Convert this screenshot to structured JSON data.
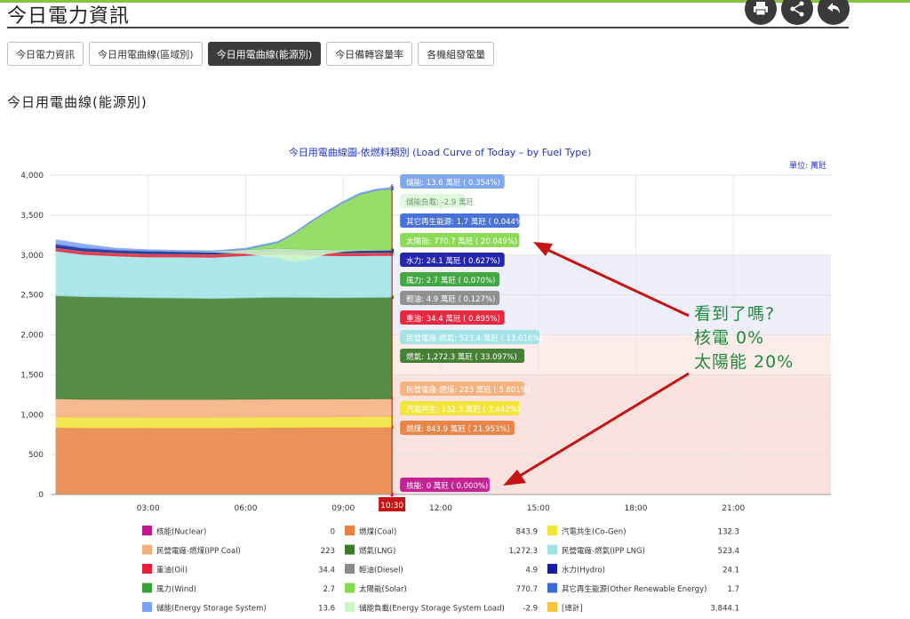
{
  "header": {
    "title": "今日電力資訊",
    "buttons": [
      {
        "name": "print-button",
        "icon": "printer-icon"
      },
      {
        "name": "share-button",
        "icon": "share-icon"
      },
      {
        "name": "back-button",
        "icon": "back-arrow-icon"
      }
    ]
  },
  "tabs": [
    {
      "label": "今日電力資訊",
      "active": false
    },
    {
      "label": "今日用電曲線(區域別)",
      "active": false
    },
    {
      "label": "今日用電曲線(能源別)",
      "active": true
    },
    {
      "label": "今日備轉容量率",
      "active": false
    },
    {
      "label": "各機組發電量",
      "active": false
    }
  ],
  "section_title": "今日用電曲線(能源別)",
  "chart_data": {
    "type": "area",
    "title": "今日用電曲線圖-依燃料類別 (Load Curve of Today – by Fuel Type)",
    "unit": "單位: 萬瓩",
    "ylim": [
      0,
      4000
    ],
    "yticks": [
      "0",
      "500",
      "1,000",
      "1,500",
      "2,000",
      "2,500",
      "3,000",
      "3,500",
      "4,000"
    ],
    "xlim_hours": [
      0,
      24
    ],
    "xticks": [
      "03:00",
      "06:00",
      "09:00",
      "12:00",
      "15:00",
      "18:00",
      "21:00"
    ],
    "current_time": "10:30",
    "time_points": [
      "00:10",
      "01:00",
      "02:00",
      "03:00",
      "04:00",
      "05:00",
      "06:00",
      "07:00",
      "07:30",
      "08:00",
      "08:30",
      "09:00",
      "09:30",
      "10:00",
      "10:30"
    ],
    "series": [
      {
        "name": "核能",
        "color": "#c2188f",
        "values": [
          0,
          0,
          0,
          0,
          0,
          0,
          0,
          0,
          0,
          0,
          0,
          0,
          0,
          0,
          0
        ],
        "tooltip": "核能: 0 萬瓩 ( 0.000%)"
      },
      {
        "name": "燃煤",
        "color": "#e8803f",
        "values": [
          840,
          835,
          835,
          835,
          835,
          835,
          838,
          840,
          840,
          842,
          842,
          843,
          843,
          844,
          843.9
        ],
        "tooltip": "燃煤: 843.9 萬瓩 ( 21.953%)"
      },
      {
        "name": "汽電共生",
        "color": "#f2e533",
        "values": [
          135,
          134,
          134,
          133,
          133,
          133,
          133,
          133,
          133,
          132,
          132,
          132,
          132,
          132,
          132.3
        ],
        "tooltip": "汽電共生: 132.3 萬瓩 ( 3.442%)"
      },
      {
        "name": "民營電廠-燃煤",
        "color": "#f4b07c",
        "values": [
          226,
          225,
          225,
          224,
          224,
          224,
          224,
          224,
          223,
          223,
          223,
          223,
          223,
          223,
          223
        ],
        "tooltip": "民營電廠-燃煤: 223 萬瓩 ( 5.801%)"
      },
      {
        "name": "燃氣",
        "color": "#3b7a2a",
        "values": [
          1290,
          1285,
          1280,
          1275,
          1270,
          1265,
          1270,
          1275,
          1275,
          1272,
          1270,
          1268,
          1270,
          1272,
          1272.3
        ],
        "tooltip": "燃氣: 1,272.3 萬瓩 ( 33.097%)"
      },
      {
        "name": "民營電廠-燃氣",
        "color": "#9fe3e6",
        "values": [
          560,
          530,
          515,
          510,
          515,
          515,
          530,
          540,
          535,
          530,
          528,
          525,
          524,
          523,
          523.4
        ],
        "tooltip": "民營電廠-燃氣: 523.4 萬瓩 ( 13.616%)"
      },
      {
        "name": "重油",
        "color": "#e81e3a",
        "values": [
          38,
          37,
          36,
          36,
          35,
          35,
          35,
          35,
          35,
          35,
          35,
          35,
          35,
          34,
          34.4
        ],
        "tooltip": "重油: 34.4 萬瓩 ( 0.895%)"
      },
      {
        "name": "輕油",
        "color": "#8a8a8a",
        "values": [
          5,
          5,
          5,
          5,
          5,
          5,
          5,
          5,
          5,
          5,
          5,
          5,
          5,
          5,
          4.9
        ],
        "tooltip": "輕油: 4.9 萬瓩 ( 0.127%)"
      },
      {
        "name": "風力",
        "color": "#3aa23a",
        "values": [
          3,
          3,
          3,
          3,
          3,
          3,
          3,
          3,
          3,
          3,
          3,
          3,
          3,
          3,
          2.7
        ],
        "tooltip": "風力: 2.7 萬瓩 ( 0.070%)"
      },
      {
        "name": "水力",
        "color": "#1a1aa8",
        "values": [
          40,
          35,
          30,
          28,
          25,
          25,
          25,
          25,
          24,
          24,
          24,
          24,
          24,
          24,
          24.1
        ],
        "tooltip": "水力: 24.1 萬瓩 ( 0.627%)"
      },
      {
        "name": "太陽能",
        "color": "#86d84f",
        "values": [
          0,
          0,
          0,
          0,
          0,
          0,
          10,
          80,
          200,
          350,
          480,
          600,
          700,
          750,
          770.7
        ],
        "tooltip": "太陽能: 770.7 萬瓩 ( 20.049%)"
      },
      {
        "name": "其它再生能源",
        "color": "#3f6ad6",
        "values": [
          2,
          2,
          2,
          2,
          2,
          2,
          2,
          2,
          2,
          2,
          2,
          2,
          2,
          2,
          1.7
        ],
        "tooltip": "其它再生能源: 1.7 萬瓩 ( 0.044%)"
      },
      {
        "name": "儲能",
        "color": "#7aa2f0",
        "values": [
          50,
          45,
          20,
          15,
          10,
          10,
          10,
          8,
          5,
          5,
          5,
          10,
          12,
          13,
          13.6
        ],
        "tooltip": "儲能: 13.6 萬瓩 ( 0.354%)"
      }
    ],
    "negative_series": {
      "name": "儲能負載",
      "color": "#cdf5c8",
      "values": [
        0,
        0,
        0,
        0,
        -5,
        -10,
        -60,
        -150,
        -200,
        -150,
        -60,
        -20,
        -10,
        -5,
        -2.9
      ],
      "tooltip": "儲能負載: -2.9 萬瓩"
    },
    "bands": [
      {
        "from": 0,
        "to": 1500,
        "color": "#f6d5d0"
      },
      {
        "from": 1500,
        "to": 2000,
        "color": "#fbe6e3"
      },
      {
        "from": 2000,
        "to": 3000,
        "color": "#e8e8f6"
      }
    ],
    "legend": [
      {
        "label": "核能(Nuclear)",
        "value": "0",
        "color": "#c2188f"
      },
      {
        "label": "燃煤(Coal)",
        "value": "843.9",
        "color": "#e8803f"
      },
      {
        "label": "汽電共生(Co-Gen)",
        "value": "132.3",
        "color": "#f2e533"
      },
      {
        "label": "民營電廠-燃煤(IPP Coal)",
        "value": "223",
        "color": "#f4b07c"
      },
      {
        "label": "燃氣(LNG)",
        "value": "1,272.3",
        "color": "#3b7a2a"
      },
      {
        "label": "民營電廠-燃氣(IPP LNG)",
        "value": "523.4",
        "color": "#9fe3e6"
      },
      {
        "label": "重油(Oil)",
        "value": "34.4",
        "color": "#e81e3a"
      },
      {
        "label": "輕油(Diesel)",
        "value": "4.9",
        "color": "#8a8a8a"
      },
      {
        "label": "水力(Hydro)",
        "value": "24.1",
        "color": "#1a1aa8"
      },
      {
        "label": "風力(Wind)",
        "value": "2.7",
        "color": "#3aa23a"
      },
      {
        "label": "太陽能(Solar)",
        "value": "770.7",
        "color": "#86d84f"
      },
      {
        "label": "其它再生能源(Other Renewable Energy)",
        "value": "1.7",
        "color": "#3f6ad6"
      },
      {
        "label": "儲能(Energy Storage System)",
        "value": "13.6",
        "color": "#7aa2f0"
      },
      {
        "label": "儲能負載(Energy Storage System Load)",
        "value": "-2.9",
        "color": "#cdf5c8"
      },
      {
        "label": "[總計]",
        "value": "3,844.1",
        "color": "#f5c542"
      }
    ]
  },
  "annotation": {
    "lines": [
      "看到了嗎?",
      "核電 0%",
      "太陽能 20%"
    ],
    "arrow_color": "#c41414"
  }
}
